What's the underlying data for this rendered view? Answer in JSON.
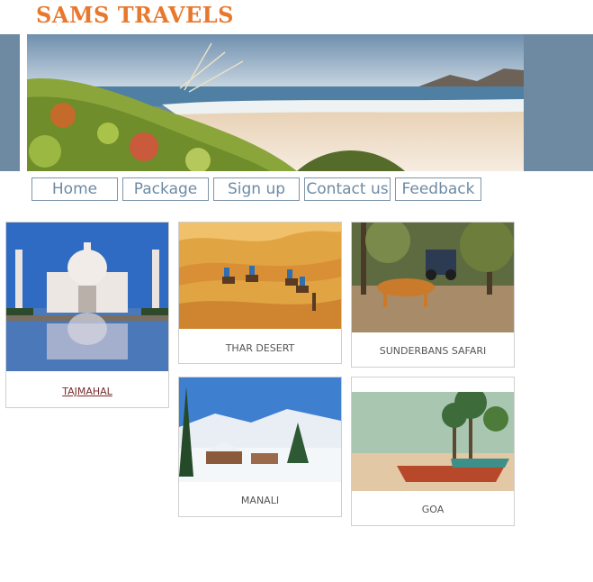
{
  "brand": {
    "title": "SAMS TRAVELS"
  },
  "nav": {
    "home": "Home",
    "package": "Package",
    "signup": "Sign up",
    "contact": "Contact us",
    "feedback": "Feedback"
  },
  "packages": {
    "tajmahal": "TAJMAHAL",
    "thar": "THAR DESERT",
    "sunderbans": "SUNDERBANS SAFARI",
    "manali": "MANALI",
    "goa": "GOA"
  },
  "colors": {
    "brand": "#e8782c",
    "band": "#6e8aa3",
    "nav_text": "#6e8aa3"
  }
}
